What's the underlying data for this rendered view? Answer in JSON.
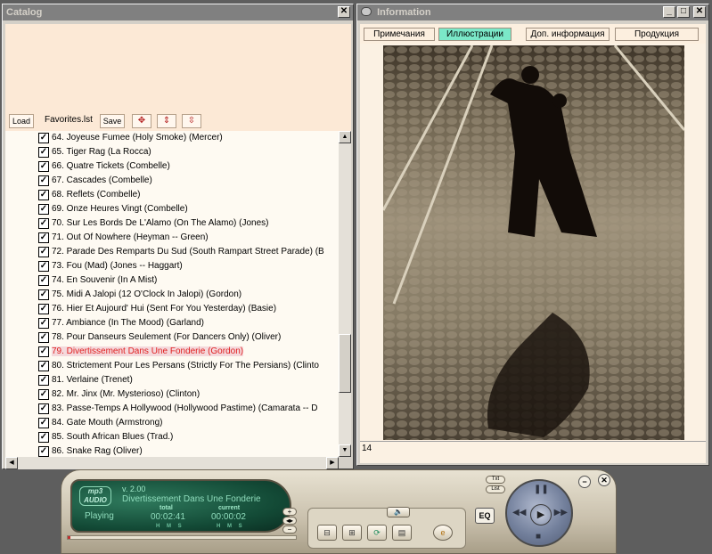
{
  "catalog": {
    "title": "Catalog",
    "close_glyph": "✕",
    "toolbar": {
      "load_label": "Load",
      "file_name": "Favorites.lst",
      "save_label": "Save",
      "icons": [
        "move-all-icon",
        "move-up-down-icon",
        "move-up-down-alt-icon"
      ]
    },
    "items": [
      {
        "label": "64. Joyeuse Fumee (Holy Smoke) (Mercer)",
        "checked": true
      },
      {
        "label": "65. Tiger Rag (La Rocca)",
        "checked": true
      },
      {
        "label": "66. Quatre Tickets (Combelle)",
        "checked": true
      },
      {
        "label": "67. Cascades (Combelle)",
        "checked": true
      },
      {
        "label": "68. Reflets (Combelle)",
        "checked": true
      },
      {
        "label": "69. Onze Heures Vingt (Combelle)",
        "checked": true
      },
      {
        "label": "70. Sur Les Bords De L'Alamo (On The Alamo) (Jones)",
        "checked": true
      },
      {
        "label": "71. Out Of Nowhere (Heyman -- Green)",
        "checked": true
      },
      {
        "label": "72. Parade Des Remparts Du Sud (South Rampart Street Parade) (B",
        "checked": true
      },
      {
        "label": "73. Fou (Mad) (Jones -- Haggart)",
        "checked": true
      },
      {
        "label": "74. En Souvenir (In A Mist)",
        "checked": true
      },
      {
        "label": "75. Midi A Jalopi (12 O'Clock In Jalopi) (Gordon)",
        "checked": true
      },
      {
        "label": "76. Hier Et Aujourd' Hui (Sent For You Yesterday) (Basie)",
        "checked": true
      },
      {
        "label": "77. Ambiance (In The Mood) (Garland)",
        "checked": true
      },
      {
        "label": "78. Pour Danseurs Seulement (For Dancers Only) (Oliver)",
        "checked": true
      },
      {
        "label": "79. Divertissement Dans Une Fonderie (Gordon)",
        "checked": true,
        "active": true
      },
      {
        "label": "80. Strictement Pour Les Persans (Strictly For The Persians) (Clinto",
        "checked": true
      },
      {
        "label": "81. Verlaine (Trenet)",
        "checked": true
      },
      {
        "label": "82. Mr. Jinx (Mr. Mysterioso) (Clinton)",
        "checked": true
      },
      {
        "label": "83. Passe-Temps A Hollywood (Hollywood Pastime) (Camarata -- D",
        "checked": true
      },
      {
        "label": "84. Gate Mouth (Armstrong)",
        "checked": true
      },
      {
        "label": "85. South African Blues (Trad.)",
        "checked": true
      },
      {
        "label": "86. Snake Rag (Oliver)",
        "checked": true
      }
    ]
  },
  "info": {
    "title": "Information",
    "tabs": [
      {
        "label": "Примечания",
        "active": false
      },
      {
        "label": "Иллюстрации",
        "active": true
      },
      {
        "label": "Доп. информация",
        "active": false
      },
      {
        "label": "Продукция",
        "active": false
      }
    ],
    "footer_value": "14"
  },
  "player": {
    "logo": "mp3 AUDIO",
    "version": "v. 2.00",
    "track": "Divertissement Dans Une Fonderie",
    "status": "Playing",
    "total_label": "total",
    "current_label": "current",
    "total_time": "00:02:41",
    "current_time": "00:00:02",
    "units": "H M S",
    "eq_label": "EQ",
    "txt_label": "Txt",
    "list_label": "List",
    "progress": 0.01
  },
  "colors": {
    "active_row": "#e02020",
    "active_tab": "#7be8c8",
    "lcd": "#134a36"
  }
}
